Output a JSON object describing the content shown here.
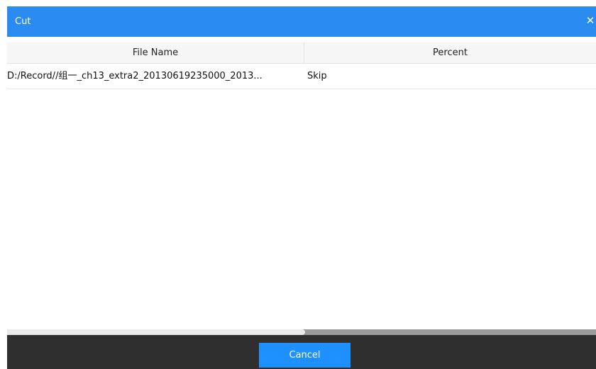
{
  "dialog": {
    "title": "Cut",
    "close_glyph": "✕",
    "accent_color": "#2a8cf0"
  },
  "table": {
    "columns": [
      "File Name",
      "Percent"
    ],
    "rows": [
      {
        "file_name": "D:/Record//组一_ch13_extra2_20130619235000_2013...",
        "percent": "Skip"
      }
    ]
  },
  "footer": {
    "cancel_label": "Cancel",
    "button_color": "#1e90ff"
  },
  "icons": {
    "close": "close-icon"
  }
}
